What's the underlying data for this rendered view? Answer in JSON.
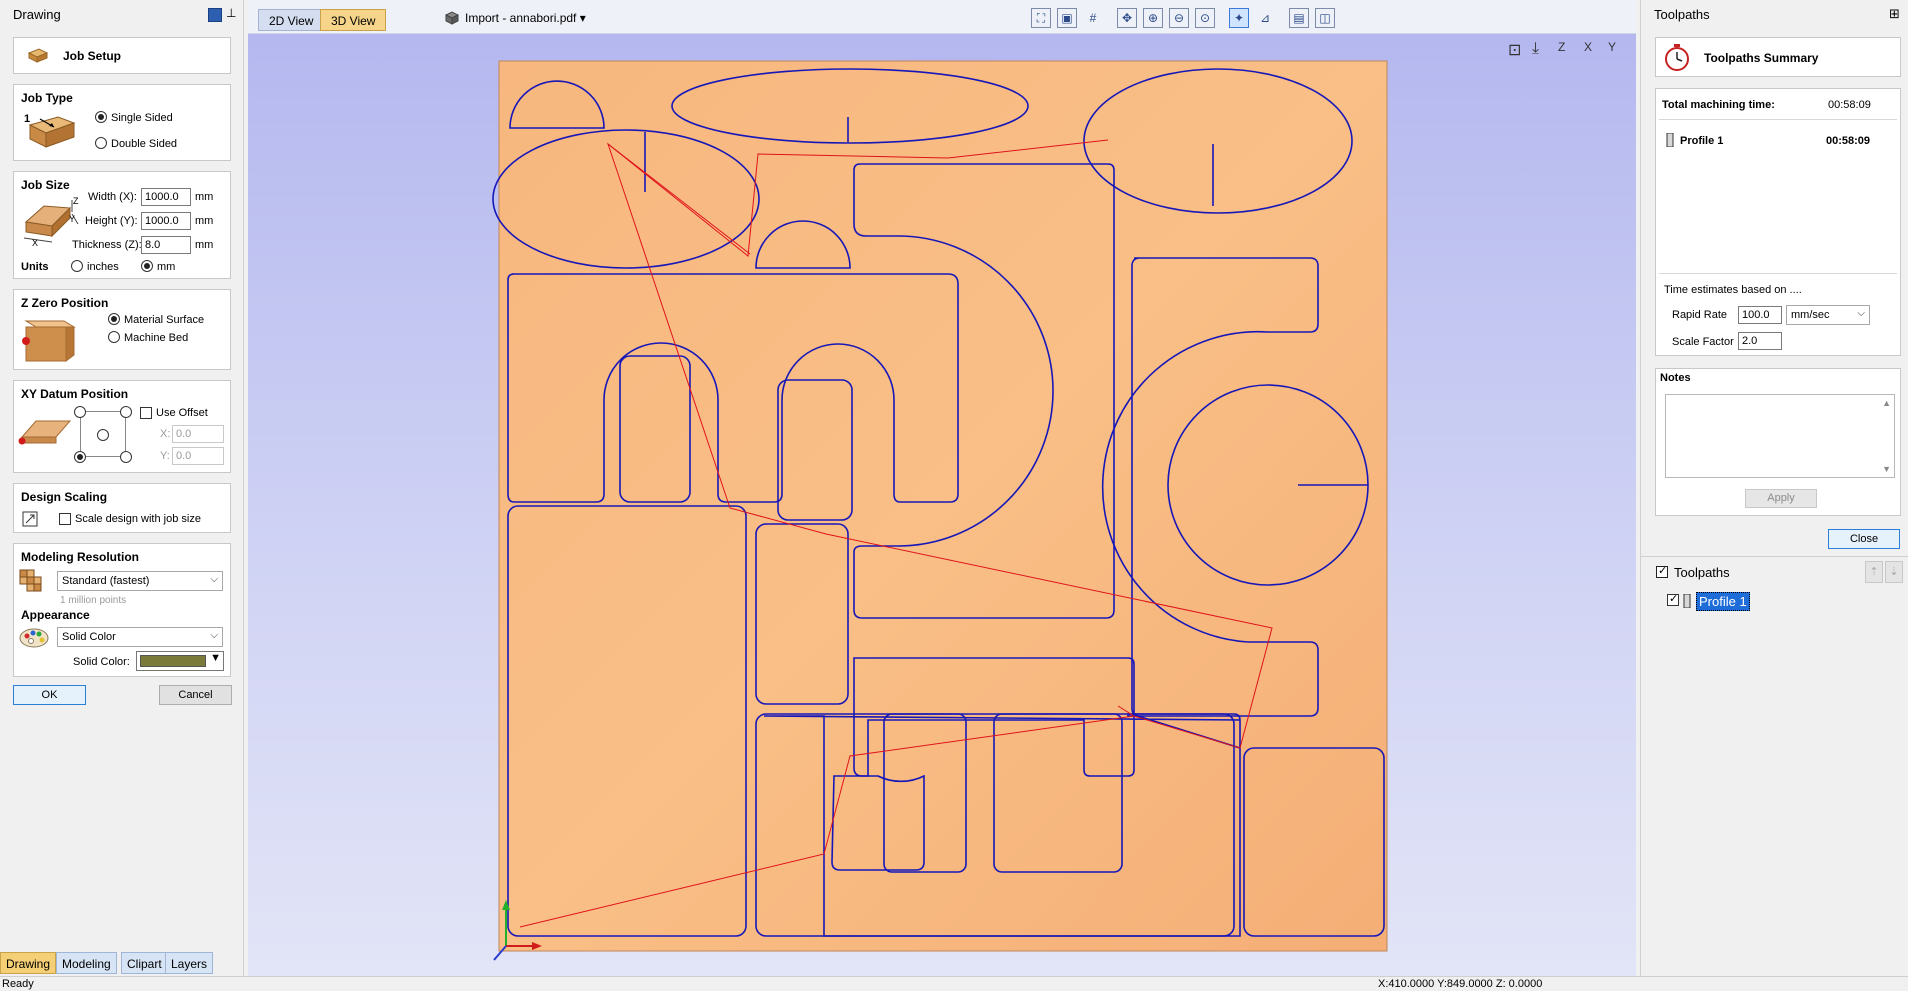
{
  "left_panel": {
    "title": "Drawing",
    "job_setup": "Job Setup",
    "job_type": {
      "title": "Job Type",
      "number": "1",
      "single": "Single Sided",
      "double": "Double Sided",
      "selected": "single"
    },
    "job_size": {
      "title": "Job Size",
      "width_label": "Width (X):",
      "width_value": "1000.0",
      "height_label": "Height (Y):",
      "height_value": "1000.0",
      "thickness_label": "Thickness (Z):",
      "thickness_value": "8.0",
      "unit": "mm",
      "units_label": "Units",
      "inches": "inches",
      "mm": "mm",
      "selected": "mm",
      "axis_z": "Z",
      "axis_y": "Y",
      "axis_x": "X"
    },
    "z_zero": {
      "title": "Z Zero Position",
      "material_surface": "Material Surface",
      "machine_bed": "Machine Bed",
      "selected": "material_surface"
    },
    "xy_datum": {
      "title": "XY Datum Position",
      "use_offset": "Use Offset",
      "x_label": "X:",
      "x_value": "0.0",
      "y_label": "Y:",
      "y_value": "0.0"
    },
    "design_scaling": {
      "title": "Design Scaling",
      "scale_label": "Scale design with job size"
    },
    "modeling_resolution": {
      "title": "Modeling Resolution",
      "value": "Standard (fastest)",
      "hint": "1 million points"
    },
    "appearance": {
      "title": "Appearance",
      "value": "Solid Color",
      "solid_color_label": "Solid Color:",
      "swatch_color": "#7a7a3a"
    },
    "ok": "OK",
    "cancel": "Cancel",
    "bottom_tabs": [
      "Drawing",
      "Modeling",
      "Clipart",
      "Layers"
    ]
  },
  "center": {
    "tabs": [
      "2D View",
      "3D View"
    ],
    "active_tab": "3D View",
    "file_label": "Import - annabori.pdf",
    "dropdown_glyph": "▾",
    "toolbar_icons": [
      "zoom-extents-icon",
      "zoom-box-icon",
      "grid-icon",
      "pan-icon",
      "zoom-in-icon",
      "zoom-out-icon",
      "zoom-selected-icon",
      "light-icon",
      "render-icon",
      "layout-1-icon",
      "layout-2-icon"
    ],
    "view_icons": [
      "fit-view-icon",
      "iso-view-icon",
      "z-view-icon",
      "x-view-icon",
      "y-view-icon"
    ],
    "view_icon_glyphs": [
      "⊡",
      "⤓",
      "Z",
      "X",
      "Y"
    ],
    "colors": {
      "material": "#f6b37b",
      "vector": "#1717b8",
      "rapid": "#e0121a"
    }
  },
  "right_panel": {
    "title": "Toolpaths",
    "pin_glyph": "⊞",
    "summary_title": "Toolpaths Summary",
    "total_label": "Total machining time:",
    "total_value": "00:58:09",
    "profile_name": "Profile 1",
    "profile_time": "00:58:09",
    "estimates_label": "Time estimates based on ....",
    "rapid_rate_label": "Rapid Rate",
    "rapid_rate_value": "100.0",
    "rapid_unit": "mm/sec",
    "scale_factor_label": "Scale Factor",
    "scale_factor_value": "2.0",
    "notes_title": "Notes",
    "apply": "Apply",
    "close": "Close",
    "toolpaths_header": "Toolpaths",
    "toolpath_items": [
      "Profile 1"
    ]
  },
  "status": {
    "left": "Ready",
    "right": "X:410.0000 Y:849.0000 Z: 0.0000"
  }
}
